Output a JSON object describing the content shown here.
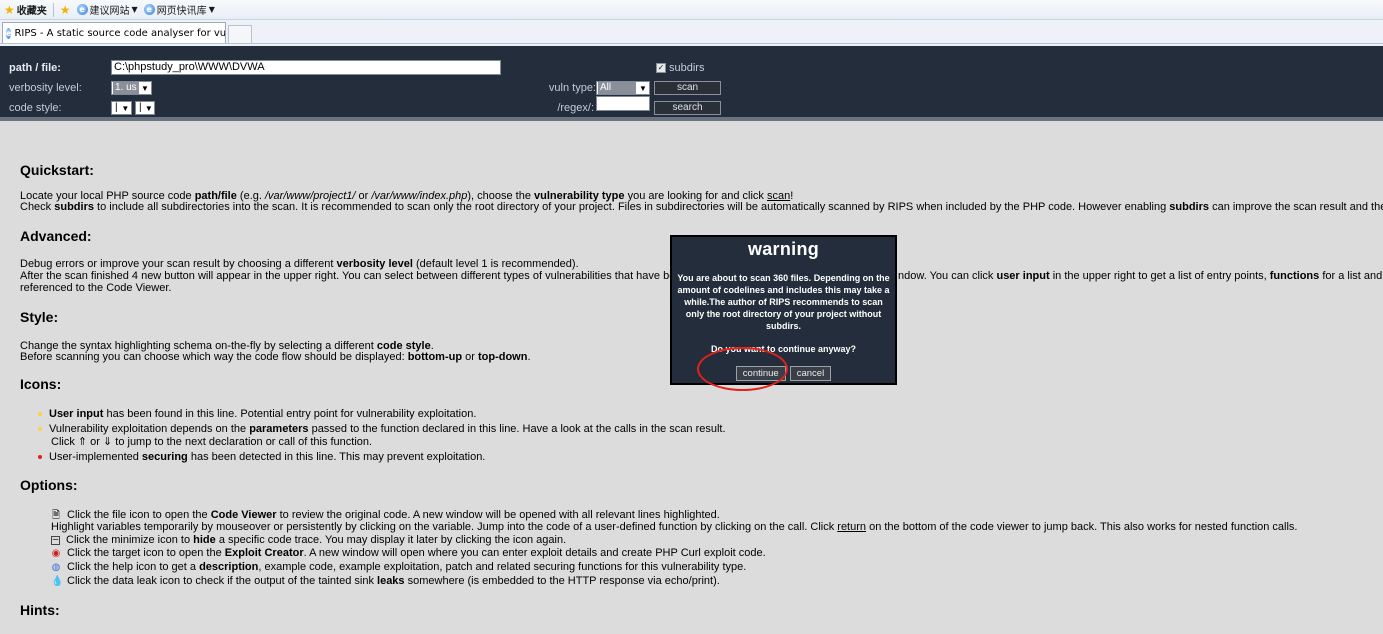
{
  "browser": {
    "favorites_label": "收藏夹",
    "suggested_sites": "建议网站",
    "web_slices": "网页快讯库",
    "tab_title": "RIPS - A static source code analyser for vuln..."
  },
  "header": {
    "path_label": "path / file:",
    "path_value": "C:\\phpstudy_pro\\WWW\\DVWA",
    "verbosity_label": "verbosity level:",
    "verbosity_value": "1. us",
    "code_style_label": "code style:",
    "code_style_value1": "|",
    "code_style_value2": "|",
    "subdirs_label": "subdirs",
    "vuln_type_label": "vuln type:",
    "vuln_type_value": "All",
    "regex_label": "/regex/:",
    "scan_button": "scan",
    "search_button": "search"
  },
  "content": {
    "quickstart": {
      "title": "Quickstart:",
      "l1_a": "Locate your local PHP source code ",
      "l1_b": "path/file",
      "l1_c": " (e.g. ",
      "l1_d": "/var/www/project1/",
      "l1_e": " or ",
      "l1_f": "/var/www/index.php",
      "l1_g": "), choose the ",
      "l1_h": "vulnerability type",
      "l1_i": " you are looking for and click ",
      "l1_j": "scan",
      "l1_k": "!",
      "l2_a": "Check ",
      "l2_b": "subdirs",
      "l2_c": " to include all subdirectories into the scan. It is recommended to scan only the root directory of your project. Files in subdirectories will be automatically scanned by RIPS when included by the PHP code. However enabling ",
      "l2_d": "subdirs",
      "l2_e": " can improve the scan result and the inclu"
    },
    "advanced": {
      "title": "Advanced:",
      "l1_a": "Debug errors or improve your scan result by choosing a different ",
      "l1_b": "verbosity level",
      "l1_c": " (default level 1 is recommended).",
      "l2_a": "After the scan finished 4 new button will appear in the upper right. You can select between different types of vulnerabilities that have bee",
      "l2_b": "ndow. You can click ",
      "l2_c": "user input",
      "l2_d": " in the upper right to get a list of entry points, ",
      "l2_e": "functions",
      "l2_f": " for a list and g",
      "l3": "referenced to the Code Viewer."
    },
    "style": {
      "title": "Style:",
      "l1_a": "Change the syntax highlighting schema on-the-fly by selecting a different ",
      "l1_b": "code style",
      "l1_c": ".",
      "l2_a": "Before scanning you can choose which way the code flow should be displayed: ",
      "l2_b": "bottom-up",
      "l2_c": " or ",
      "l2_d": "top-down",
      "l2_e": "."
    },
    "icons": {
      "title": "Icons:",
      "i1_a": "User input",
      "i1_b": " has been found in this line. Potential entry point for vulnerability exploitation.",
      "i2_a": "Vulnerability exploitation depends on the ",
      "i2_b": "parameters",
      "i2_c": " passed to the function declared in this line. Have a look at the calls in the scan result.",
      "i2_d": "Click ⇑ or ⇓ to jump to the next declaration or call of this function.",
      "i3_a": "User-implemented ",
      "i3_b": "securing",
      "i3_c": " has been detected in this line. This may prevent exploitation."
    },
    "options": {
      "title": "Options:",
      "o1_a": "Click the file icon to open the ",
      "o1_b": "Code Viewer",
      "o1_c": " to review the original code. A new window will be opened with all relevant lines highlighted.",
      "o2_a": "Highlight variables temporarily by mouseover or persistently by clicking on the variable. Jump into the code of a user-defined function by clicking on the call. Click ",
      "o2_b": "return",
      "o2_c": " on the bottom of the code viewer to jump back. This also works for nested function calls.",
      "o3_a": "Click the minimize icon to ",
      "o3_b": "hide",
      "o3_c": " a specific code trace. You may display it later by clicking the icon again.",
      "o4_a": "Click the target icon to open the ",
      "o4_b": "Exploit Creator",
      "o4_c": ". A new window will open where you can enter exploit details and create PHP Curl exploit code.",
      "o5_a": "Click the help icon to get a ",
      "o5_b": "description",
      "o5_c": ", example code, example exploitation, patch and related securing functions for this vulnerability type.",
      "o6_a": "Click the data leak icon to check if the output of the tainted sink ",
      "o6_b": "leaks",
      "o6_c": " somewhere (is embedded to the HTTP response via echo/print)."
    },
    "hints": {
      "title": "Hints:"
    }
  },
  "dialog": {
    "title": "warning",
    "message": "You are about to scan 360 files. Depending on the amount of codelines and includes this may take a while.The author of RIPS recommends to scan only the root directory of your project without subdirs.",
    "question": "Do you want to continue anyway?",
    "continue_button": "continue",
    "cancel_button": "cancel"
  },
  "colors": {
    "header_bg": "#232d3b",
    "page_bg": "#dcdcdc",
    "annotation_ring": "#e3231b",
    "bullet_user_input": "#f5d44a",
    "bullet_parameters": "#f5d44a",
    "bullet_securing": "#e02020"
  }
}
